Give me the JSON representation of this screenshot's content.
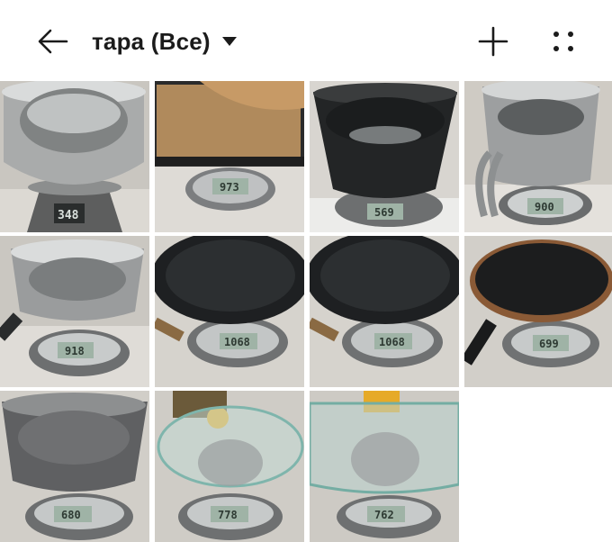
{
  "header": {
    "title": "тара (Все)",
    "back_icon": "arrow-left-icon",
    "dropdown_icon": "caret-down-icon",
    "add_icon": "plus-icon",
    "more_icon": "dots-grid-icon"
  },
  "colors": {
    "background": "#ffffff",
    "text": "#1b1b1b",
    "scale_display": "#9fb3a6",
    "counter_surface": "#e8e6e2",
    "dark_pan": "#1e2022"
  },
  "gallery": {
    "photos": [
      {
        "subject": "steel pot on kitchen scale",
        "reading": "348"
      },
      {
        "subject": "baking tray with parchment on kitchen scale",
        "reading": "973"
      },
      {
        "subject": "dark pot on kitchen scale",
        "reading": "569"
      },
      {
        "subject": "steel milk pot with handle on kitchen scale",
        "reading": "900"
      },
      {
        "subject": "steel saucepan on kitchen scale",
        "reading": "918"
      },
      {
        "subject": "frying pan with wooden handle on kitchen scale",
        "reading": "1068"
      },
      {
        "subject": "frying pan on kitchen scale",
        "reading": "1068"
      },
      {
        "subject": "black frying pan on kitchen scale",
        "reading": "699"
      },
      {
        "subject": "grey stone pot on kitchen scale",
        "reading": "680"
      },
      {
        "subject": "glass bowl on kitchen scale",
        "reading": "778"
      },
      {
        "subject": "glass baking dish on kitchen scale",
        "reading": "762"
      }
    ]
  }
}
